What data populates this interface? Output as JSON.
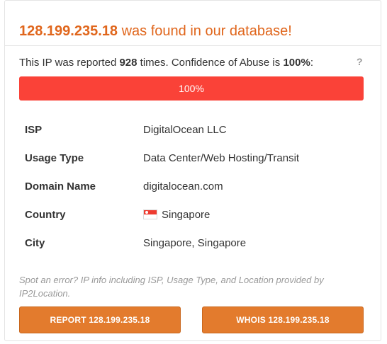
{
  "header": {
    "ip": "128.199.235.18",
    "found_text": " was found in our database!"
  },
  "report": {
    "prefix": "This IP was reported ",
    "count": "928",
    "middle": " times. Confidence of Abuse is ",
    "confidence": "100%",
    "suffix": ":",
    "help": "?"
  },
  "abuse_bar": {
    "level_percent": 100,
    "label": "100%",
    "fill_color": "#fa4238"
  },
  "info": [
    {
      "key": "ISP",
      "value": "DigitalOcean LLC"
    },
    {
      "key": "Usage Type",
      "value": "Data Center/Web Hosting/Transit"
    },
    {
      "key": "Domain Name",
      "value": "digitalocean.com"
    },
    {
      "key": "Country",
      "value": "Singapore",
      "icon": "singapore-flag-icon"
    },
    {
      "key": "City",
      "value": "Singapore, Singapore"
    }
  ],
  "note": "Spot an error? IP info including ISP, Usage Type, and Location provided by IP2Location.",
  "buttons": {
    "report": "REPORT 128.199.235.18",
    "whois": "WHOIS 128.199.235.18"
  },
  "colors": {
    "accent": "#e0661c",
    "button": "#e37b2d"
  }
}
